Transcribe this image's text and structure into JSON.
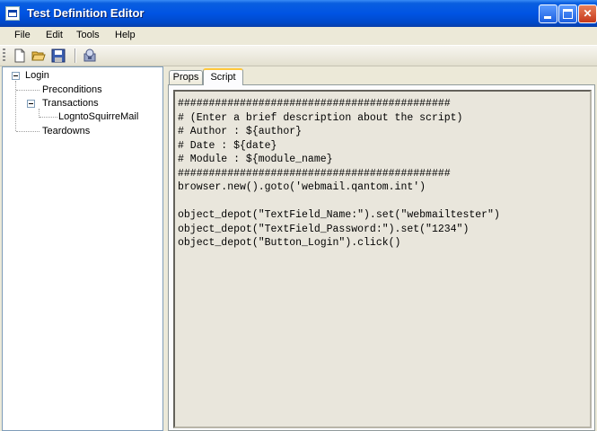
{
  "window": {
    "title": "Test Definition Editor"
  },
  "menu": [
    {
      "label": "File"
    },
    {
      "label": "Edit"
    },
    {
      "label": "Tools"
    },
    {
      "label": "Help"
    }
  ],
  "toolbar": {
    "icons": [
      "new-file-icon",
      "open-folder-icon",
      "save-icon",
      "build-icon"
    ]
  },
  "tree": {
    "root": "Login",
    "preconditions": "Preconditions",
    "transactions": "Transactions",
    "transaction_item": "LogntoSquirreMail",
    "teardowns": "Teardowns"
  },
  "tabs": [
    {
      "label": "Props"
    },
    {
      "label": "Script",
      "active": true
    }
  ],
  "script": {
    "lines": [
      "############################################",
      "# (Enter a brief description about the script)",
      "# Author : ${author}",
      "# Date : ${date}",
      "# Module : ${module_name}",
      "############################################",
      "browser.new().goto('webmail.qantom.int')",
      "",
      "object_depot(\"TextField_Name:\").set(\"webmailtester\")",
      "object_depot(\"TextField_Password:\").set(\"1234\")",
      "object_depot(\"Button_Login\").click()"
    ]
  },
  "colors": {
    "titlebar": "#0054e3",
    "menubar": "#ece9d8",
    "script_bg": "#e9e6dc",
    "tab_highlight": "#ffc83c"
  }
}
